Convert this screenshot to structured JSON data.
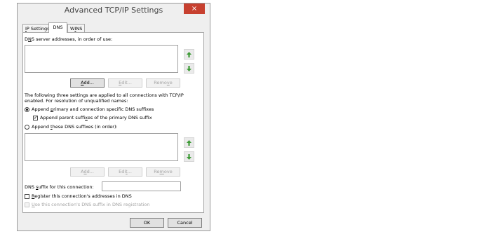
{
  "window": {
    "title": "Advanced TCP/IP Settings",
    "close_glyph": "×"
  },
  "tabs": [
    {
      "label_pre": "",
      "label_u": "I",
      "label_post": "P Settings"
    },
    {
      "label": "DNS"
    },
    {
      "label_pre": "W",
      "label_u": "I",
      "label_post": "NS"
    }
  ],
  "dns": {
    "server_label_pre": "D",
    "server_label_u": "N",
    "server_label_post": "S server addresses, in order of use:",
    "add_u": "A",
    "add_post": "dd...",
    "edit_u": "E",
    "edit_post": "dit...",
    "remove_pre": "Remo",
    "remove_u": "v",
    "remove_post": "e",
    "info_line1": "The following three settings are applied to all connections with TCP/IP",
    "info_line2": "enabled. For resolution of unqualified names:",
    "radio1_pre": "Append ",
    "radio1_u": "p",
    "radio1_post": "rimary and connection specific DNS suffixes",
    "check_parent_pre": "Append parent suffi",
    "check_parent_u": "x",
    "check_parent_post": "es of the primary DNS suffix",
    "radio2_pre": "Append ",
    "radio2_u": "t",
    "radio2_post": "hese DNS suffixes (in order):",
    "add2_pre": "A",
    "add2_u": "d",
    "add2_post": "d...",
    "edit2_pre": "Edi",
    "edit2_u": "t",
    "edit2_post": "...",
    "remove2_pre": "Re",
    "remove2_u": "m",
    "remove2_post": "ove",
    "suffix_label_pre": "DNS ",
    "suffix_label_u": "s",
    "suffix_label_post": "uffix for this connection:",
    "suffix_value": "",
    "register_u": "R",
    "register_post": "egister this connection's addresses in DNS",
    "use_u": "U",
    "use_post": "se this connection's DNS suffix in DNS registration"
  },
  "footer": {
    "ok": "OK",
    "cancel": "Cancel"
  },
  "colors": {
    "close_bg": "#c7402f",
    "arrow_green": "#3c9a35"
  },
  "icons": {
    "up": "arrow-up-icon",
    "down": "arrow-down-icon"
  }
}
